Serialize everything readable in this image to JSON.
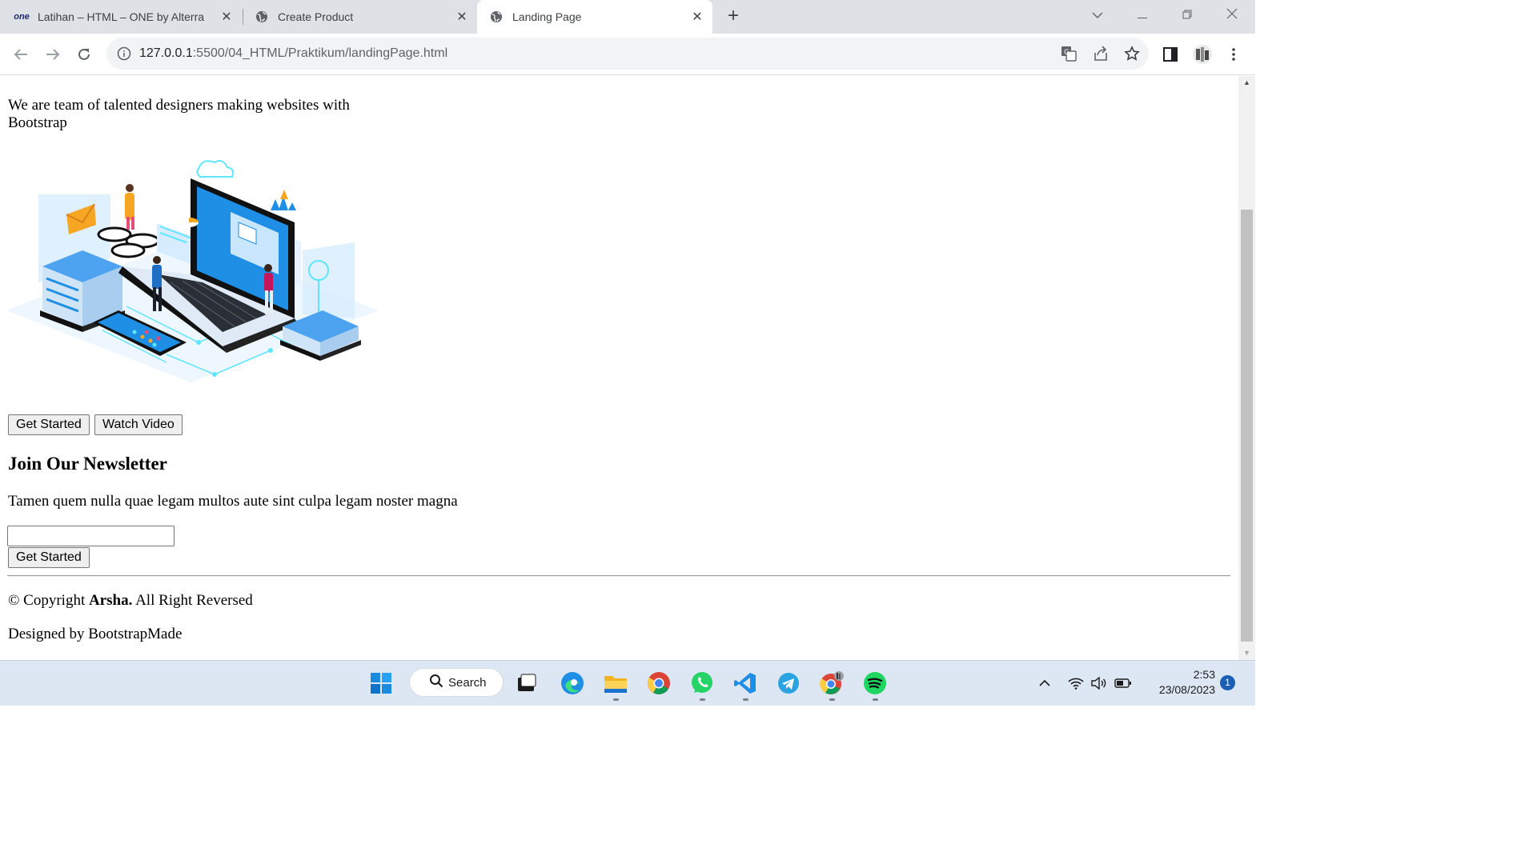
{
  "browser": {
    "tabs": [
      {
        "title": "Latihan – HTML – ONE by Alterra",
        "favicon": "one-logo",
        "active": false
      },
      {
        "title": "Create Product",
        "favicon": "globe-icon",
        "active": false
      },
      {
        "title": "Landing Page",
        "favicon": "globe-icon",
        "active": true
      }
    ],
    "new_tab_symbol": "+",
    "favicon_one_text": "one",
    "url_host": "127.0.0.1",
    "url_path": ":5500/04_HTML/Praktikum/landingPage.html"
  },
  "page": {
    "hero_text": "We are team of talented designers making websites with Bootstrap",
    "hero_buttons": {
      "get_started": "Get Started",
      "watch_video": "Watch Video"
    },
    "newsletter": {
      "title": "Join Our Newsletter",
      "description": "Tamen quem nulla quae legam multos aute sint culpa legam noster magna",
      "input_value": "",
      "submit_label": "Get Started"
    },
    "footer": {
      "copyright_prefix": "© Copyright",
      "brand": "Arsha.",
      "copyright_suffix": "All Right Reversed",
      "designed_by": "Designed by BootstrapMade"
    }
  },
  "taskbar": {
    "search_label": "Search",
    "time": "2:53",
    "date": "23/08/2023",
    "notification_count": "1"
  },
  "colors": {
    "tabstrip": "#dee1e6",
    "omnibox": "#f1f3f4",
    "taskbar": "#dde6f3",
    "illustration_blue": "#1f8fe6",
    "illustration_cyan": "#5ee6ff"
  }
}
